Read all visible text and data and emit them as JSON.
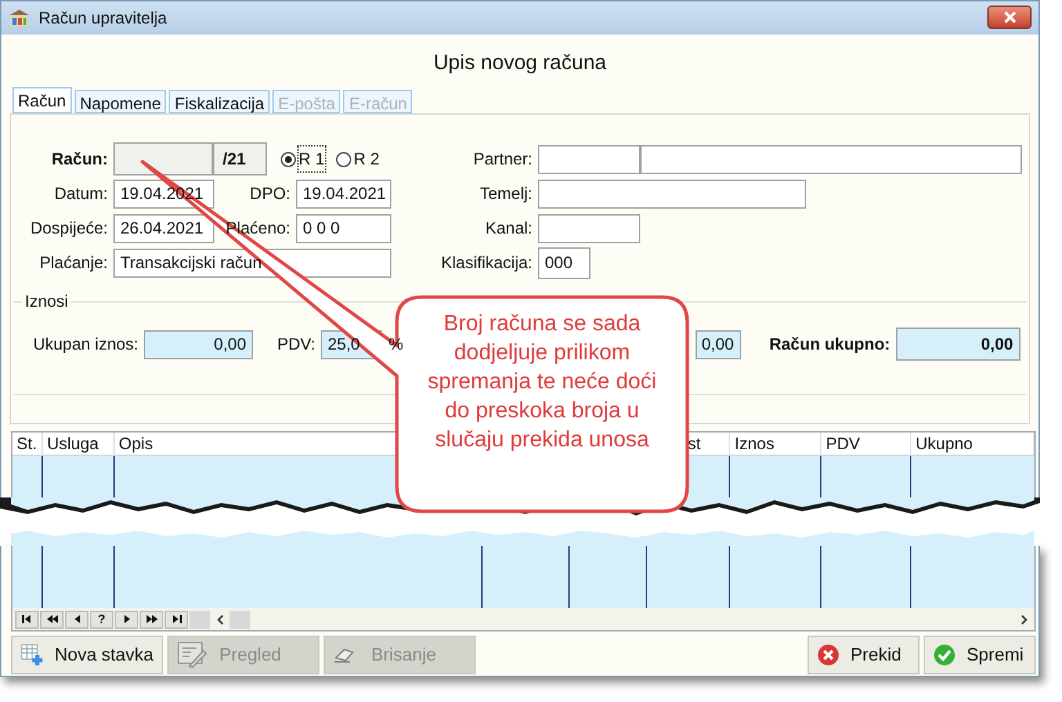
{
  "window": {
    "title": "Račun upravitelja"
  },
  "heading": "Upis novog računa",
  "tabs": [
    {
      "label": "Račun",
      "selected": true,
      "disabled": false
    },
    {
      "label": "Napomene",
      "selected": false,
      "disabled": false
    },
    {
      "label": "Fiskalizacija",
      "selected": false,
      "disabled": false
    },
    {
      "label": "E-pošta",
      "selected": false,
      "disabled": true
    },
    {
      "label": "E-račun",
      "selected": false,
      "disabled": true
    }
  ],
  "invoice": {
    "label": "Račun:",
    "suffix": "/21",
    "types": [
      {
        "label": "R 1",
        "selected": true
      },
      {
        "label": "R 2",
        "selected": false
      }
    ]
  },
  "dates": [
    {
      "label": "Datum:",
      "value": "19.04.2021"
    },
    {
      "label": "DPO:",
      "value": "19.04.2021"
    },
    {
      "label": "Dospijeće:",
      "value": "26.04.2021"
    },
    {
      "label": "Plaćeno:",
      "value": "0 0 0"
    }
  ],
  "payment": {
    "label": "Plaćanje:",
    "value": "Transakcijski račun"
  },
  "partner_fields": [
    {
      "label": "Partner:"
    },
    {
      "label": "Temelj:"
    },
    {
      "label": "Kanal:"
    },
    {
      "label": "Klasifikacija:",
      "value": "000"
    }
  ],
  "amounts": {
    "title": "Iznosi",
    "total": {
      "label": "Ukupan iznos:",
      "value": "0,00"
    },
    "vat": {
      "label": "PDV:",
      "value": "25,0",
      "unit": "%"
    },
    "vat_amount": {
      "value": "0,00"
    },
    "invoice_total": {
      "label": "Račun ukupno:",
      "value": "0,00"
    }
  },
  "grid": {
    "columns": [
      {
        "label": "St."
      },
      {
        "label": "Usluga"
      },
      {
        "label": "Opis"
      },
      {},
      {},
      {
        "label": "st"
      },
      {
        "label": "Iznos"
      },
      {
        "label": "PDV"
      },
      {
        "label": "Ukupno"
      }
    ]
  },
  "navigator": [
    {
      "kind": "first"
    },
    {
      "kind": "prior_page"
    },
    {
      "kind": "prior"
    },
    {
      "kind": "help",
      "label": "?"
    },
    {
      "kind": "next"
    },
    {
      "kind": "next_page"
    },
    {
      "kind": "last"
    }
  ],
  "actions": [
    {
      "kind": "add",
      "label": "Nova stavka",
      "disabled": false
    },
    {
      "kind": "edit",
      "label": "Pregled",
      "disabled": true
    },
    {
      "kind": "delete",
      "label": "Brisanje",
      "disabled": true
    },
    {
      "kind": "cancel",
      "label": "Prekid",
      "disabled": false
    },
    {
      "kind": "save",
      "label": "Spremi",
      "disabled": false
    }
  ],
  "callout": "Broj računa se sada dodjeljuje prilikom spremanja te neće doći do preskoka broja u slučaju prekida unosa"
}
